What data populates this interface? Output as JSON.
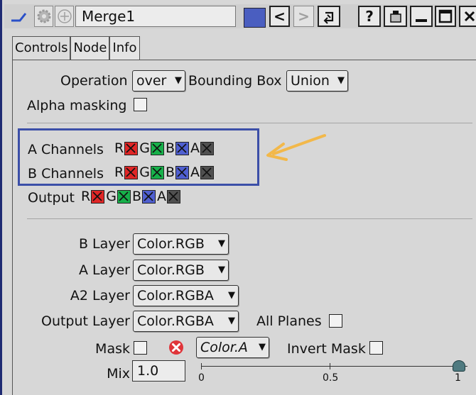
{
  "window": {
    "title": "Merge1"
  },
  "titlebar": {
    "help_label": "?",
    "back_label": "<",
    "forward_label": ">",
    "accent_color": "#4a5ec0"
  },
  "tabs": [
    "Controls",
    "Node",
    "Info"
  ],
  "operation": {
    "label": "Operation",
    "value": "over"
  },
  "bounding_box": {
    "label": "Bounding Box",
    "value": "Union"
  },
  "alpha_masking": {
    "label": "Alpha masking",
    "checked": false
  },
  "a_channels": {
    "label": "A Channels",
    "channels": [
      "R",
      "G",
      "B",
      "A"
    ]
  },
  "b_channels": {
    "label": "B Channels",
    "channels": [
      "R",
      "G",
      "B",
      "A"
    ]
  },
  "output": {
    "label": "Output",
    "channels": [
      "R",
      "G",
      "B",
      "A"
    ]
  },
  "channel_colors": {
    "R": "#e02626",
    "G": "#17b04a",
    "B": "#4f5fd0",
    "A": "#505050"
  },
  "b_layer": {
    "label": "B Layer",
    "value": "Color.RGB"
  },
  "a_layer": {
    "label": "A Layer",
    "value": "Color.RGB"
  },
  "a2_layer": {
    "label": "A2 Layer",
    "value": "Color.RGBA"
  },
  "output_layer": {
    "label": "Output Layer",
    "value": "Color.RGBA"
  },
  "all_planes": {
    "label": "All Planes",
    "checked": false
  },
  "mask": {
    "label": "Mask",
    "value": "Color.A",
    "checked": false
  },
  "invert_mask": {
    "label": "Invert Mask",
    "checked": false
  },
  "mix": {
    "label": "Mix",
    "value": "1.0",
    "slider_value": 1.0,
    "ticks": [
      "0",
      "0.5",
      "1"
    ]
  },
  "annotation": {
    "color": "#f2b84a",
    "highlight_color": "#3c4fa8"
  }
}
